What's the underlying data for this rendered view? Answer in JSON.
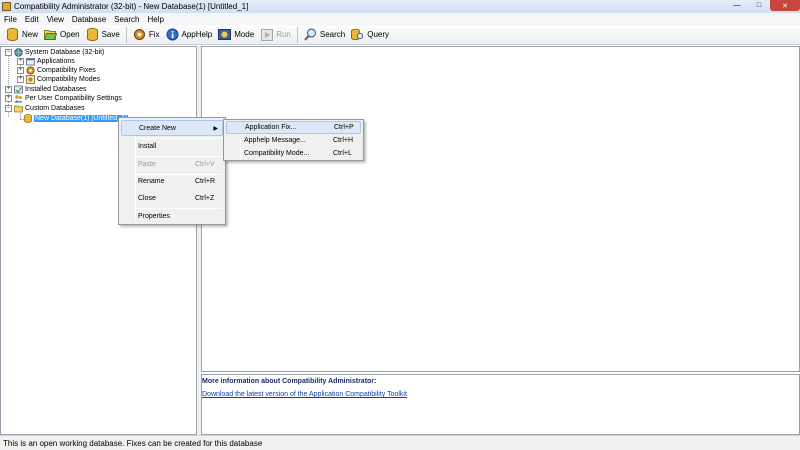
{
  "window": {
    "title": "Compatibility Administrator (32-bit) - New Database(1) [Untitled_1]",
    "controls": {
      "minimize": "—",
      "maximize": "□",
      "close": "✕"
    }
  },
  "menubar": [
    "File",
    "Edit",
    "View",
    "Database",
    "Search",
    "Help"
  ],
  "toolbar": {
    "new_label": "New",
    "open_label": "Open",
    "save_label": "Save",
    "fix_label": "Fix",
    "apphelp_label": "AppHelp",
    "mode_label": "Mode",
    "run_label": "Run",
    "search_label": "Search",
    "query_label": "Query"
  },
  "tree": {
    "system_db": "System Database (32-bit)",
    "applications": "Applications",
    "compat_fixes": "Compatibility Fixes",
    "compat_modes": "Compatibility Modes",
    "installed_dbs": "Installed Databases",
    "per_user": "Per User Compatibility Settings",
    "custom_dbs": "Custom Databases",
    "new_db": "New Database(1) [Untitled_1]",
    "expand_symbol": "+",
    "collapse_symbol": "−"
  },
  "context_menu": {
    "create_new": "Create New",
    "submenu_arrow": "▶",
    "install": "Install",
    "paste": "Paste",
    "paste_shortcut": "Ctrl+V",
    "rename": "Rename",
    "rename_shortcut": "Ctrl+R",
    "close": "Close",
    "close_shortcut": "Ctrl+Z",
    "properties": "Properties"
  },
  "submenu": {
    "application_fix": "Application Fix...",
    "application_fix_shortcut": "Ctrl+P",
    "apphelp_message": "Apphelp Message...",
    "apphelp_message_shortcut": "Ctrl+H",
    "compat_mode": "Compatibility Mode...",
    "compat_mode_shortcut": "Ctrl+L"
  },
  "info_panel": {
    "title": "More information about Compatibility Administrator:",
    "link": "Download the latest version of the Application Compatibility Toolkit"
  },
  "statusbar": {
    "text": "This is an open working database. Fixes can be created for this database"
  },
  "colors": {
    "selection": "#3399ff",
    "menu_highlight": "#dce8f7",
    "link": "#0b3fb0"
  }
}
